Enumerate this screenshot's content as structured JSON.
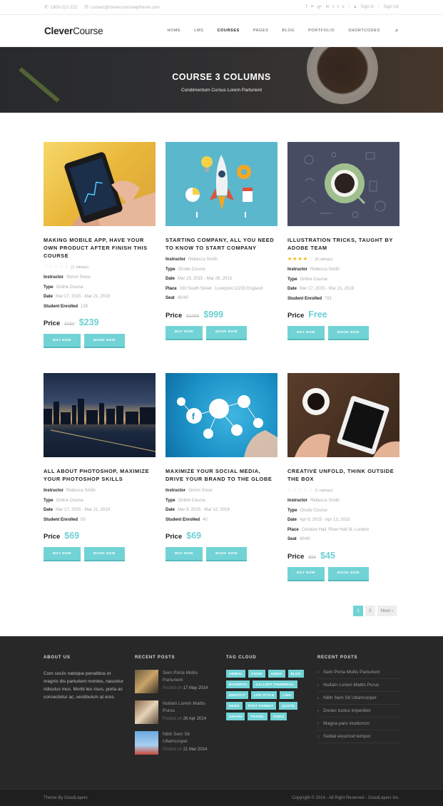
{
  "topbar": {
    "phone": "1800-222-222",
    "email": "contact@clevercoursewptheme.com",
    "social": [
      "f",
      "••",
      "g+",
      "in",
      "t",
      "t",
      "v"
    ],
    "signin": "Sign In",
    "signup": "Sign Up"
  },
  "header": {
    "logo_a": "Clever",
    "logo_b": "Course",
    "nav": [
      "HOME",
      "LMS",
      "COURSES",
      "PAGES",
      "BLOG",
      "PORTFOLIO",
      "SHORTCODES"
    ]
  },
  "hero": {
    "title": "COURSE 3 COLUMNS",
    "subtitle": "Condimentum Cursus Lorem Parturient"
  },
  "labels": {
    "instructor": "Instructor",
    "type": "Type",
    "date": "Date",
    "place": "Place",
    "seat": "Seat",
    "enrolled": "Student Enrolled",
    "price": "Price",
    "buy": "BUY NOW",
    "book": "BOOK NOW"
  },
  "courses": [
    {
      "title": "MAKING MOBILE APP, HAVE YOUR OWN PRODUCT AFTER FINISH THIS COURSE",
      "rating_count": "(1 ratings)",
      "instructor": "Simon Snow",
      "type": "Online Course",
      "date": "Mar 17, 2015 - Mar 21, 2019",
      "enrolled": "139",
      "old_price": "$250",
      "price": "$239"
    },
    {
      "title": "STARTING COMPANY, ALL YOU NEED TO KNOW TO START COMPANY",
      "instructor": "Rebecca Smith",
      "type": "Onsite Course",
      "date": "Mar 23, 2015 - Mar 26, 2015",
      "place": "150 South Street , Liverpool 12233 England",
      "seat": "40/40",
      "old_price": "$1099",
      "price": "$999"
    },
    {
      "title": "ILLUSTRATION TRICKS, TAUGHT BY ADOBE TEAM",
      "rating_count": "(8 ratings)",
      "instructor": "Rebecca Smith",
      "type": "Online Course",
      "date": "Mar 17, 2015 - Mar 21, 2019",
      "enrolled": "781",
      "price": "Free"
    },
    {
      "title": "ALL ABOUT PHOTOSHOP, MAXIMIZE YOUR PHOTOSHOP SKILLS",
      "instructor": "Rebecca Smith",
      "type": "Online Course",
      "date": "Mar 17, 2015 - Mar 21, 2019",
      "enrolled": "50",
      "price": "$69"
    },
    {
      "title": "MAXIMIZE YOUR SOCIAL MEDIA, DRIVE YOUR BRAND TO THE GLOBE",
      "instructor": "Simon Snow",
      "type": "Online Course",
      "date": "Mar 9, 2015 - Mar 12, 2019",
      "enrolled": "40",
      "price": "$69"
    },
    {
      "title": "CREATIVE UNFOLD, THINK OUTSIDE THE BOX",
      "rating_count": "(1 ratings)",
      "instructor": "Rebecca Smith",
      "type": "Onsite Course",
      "date": "Apr 9, 2015 - Apr 13, 2015",
      "place": "Creative Hall, River Hall St. London",
      "seat": "40/40",
      "old_price": "$69",
      "price": "$45"
    }
  ],
  "pagination": {
    "pages": [
      "1",
      "2"
    ],
    "next": "Next ›"
  },
  "footer": {
    "about_title": "ABOUT US",
    "about_text": "Cum sociis natoque penatibus et magnis dis parturient montes, nascetur ridiculus mus. Morbi leo risus, porta ac consectetur ac, vestibulum at eros.",
    "recent_title": "RECENT POSTS",
    "posts": [
      {
        "title": "Sem Porta Mollis Parturient",
        "prefix": "Posted on",
        "date": "17 May 2014"
      },
      {
        "title": "Nullam Lorem Mattis Purus",
        "prefix": "Posted on",
        "date": "26 Apr 2014"
      },
      {
        "title": "Nibh Sem Sit Ullamcorper",
        "prefix": "Posted on",
        "date": "21 Mar 2014"
      }
    ],
    "tag_title": "TAG CLOUD",
    "tags": [
      "ANIMAL",
      "ASIDE",
      "AUDIO",
      "BLOG",
      "BUSINESS",
      "GALLERY THUMBNAIL",
      "IDENTITY",
      "LIFE STYLE",
      "LINK",
      "NEWS",
      "POST FORMAT",
      "QUOTE",
      "SAFARI",
      "TRAVEL",
      "VIDEO"
    ],
    "recent2_title": "RECENT POSTS",
    "recent2": [
      "Sem Porta Mollis Parturient",
      "Nullam Lorem Mattis Purus",
      "Nibh Sem Sit Ullamcorper",
      "Donec luctus imperdiet",
      "Magna pars studiorum",
      "Sedial eiusmod tempor"
    ],
    "theme_by": "Theme By GoodLayers",
    "copyright": "Copyright © 2014 - All Right Reserved - GoodLayers Inc."
  },
  "colors": {
    "accent": "#72d3d6",
    "price": "#6fcfd3",
    "star": "#f5b400",
    "footer": "#282828"
  }
}
